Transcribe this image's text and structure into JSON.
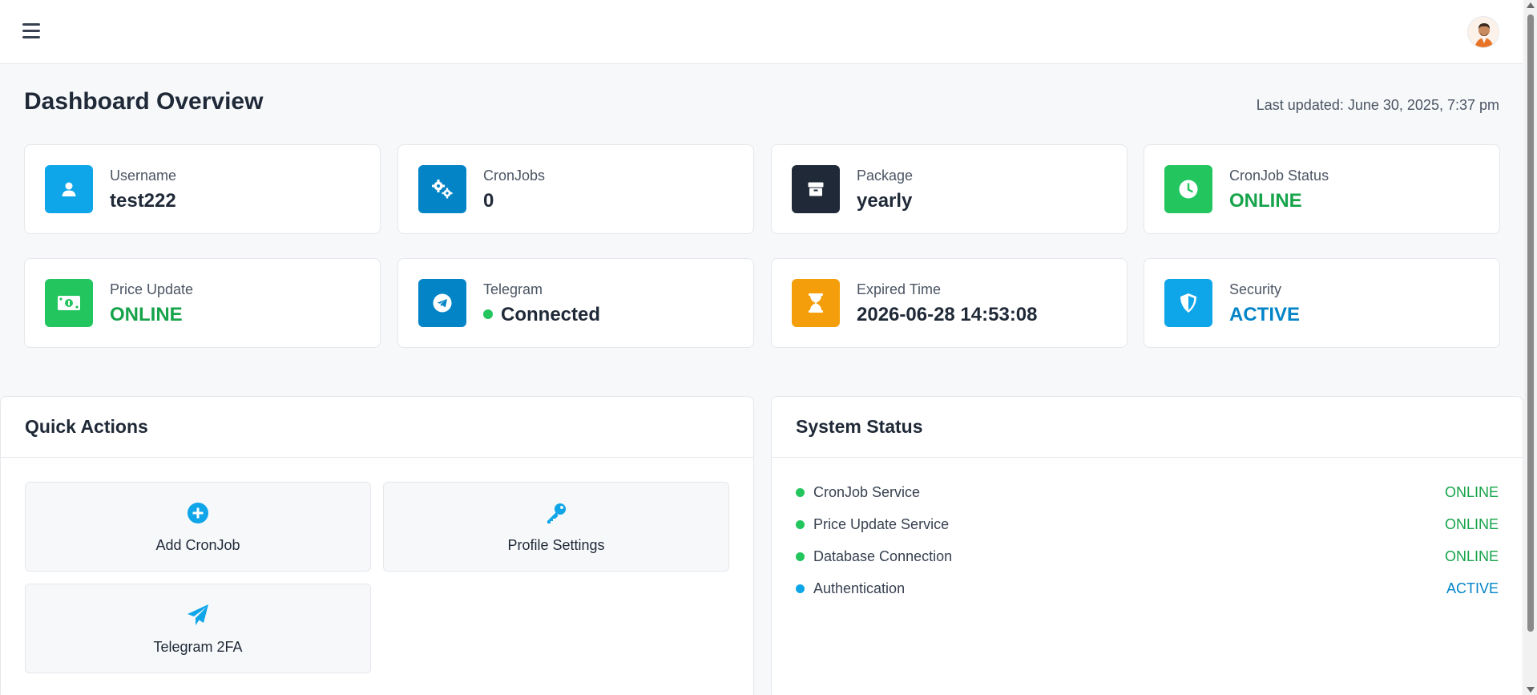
{
  "header": {
    "menu_icon": "hamburger-menu-icon",
    "avatar_icon": "user-avatar"
  },
  "page": {
    "title": "Dashboard Overview",
    "last_updated": "Last updated: June 30, 2025, 7:37 pm"
  },
  "stats": [
    {
      "label": "Username",
      "value": "test222",
      "icon": "user-icon",
      "color": "#0ea5e9"
    },
    {
      "label": "CronJobs",
      "value": "0",
      "icon": "gears-icon",
      "color": "#0284c7"
    },
    {
      "label": "Package",
      "value": "yearly",
      "icon": "box-icon",
      "color": "#1f2937"
    },
    {
      "label": "CronJob Status",
      "value": "ONLINE",
      "icon": "clock-icon",
      "color": "#22c55e"
    },
    {
      "label": "Price Update",
      "value": "ONLINE",
      "icon": "money-icon",
      "color": "#22c55e"
    },
    {
      "label": "Telegram",
      "value": "Connected",
      "icon": "telegram-icon",
      "color": "#0284c7"
    },
    {
      "label": "Expired Time",
      "value": "2026-06-28 14:53:08",
      "icon": "hourglass-icon",
      "color": "#f59e0b"
    },
    {
      "label": "Security",
      "value": "ACTIVE",
      "icon": "shield-icon",
      "color": "#0ea5e9"
    }
  ],
  "quick_actions": {
    "title": "Quick Actions",
    "items": [
      {
        "label": "Add CronJob",
        "icon": "plus-circle-icon"
      },
      {
        "label": "Profile Settings",
        "icon": "key-icon"
      },
      {
        "label": "Telegram 2FA",
        "icon": "paper-plane-icon"
      }
    ]
  },
  "system_status": {
    "title": "System Status",
    "items": [
      {
        "name": "CronJob Service",
        "status": "ONLINE",
        "color": "#16a34a",
        "dot": "#22c55e"
      },
      {
        "name": "Price Update Service",
        "status": "ONLINE",
        "color": "#16a34a",
        "dot": "#22c55e"
      },
      {
        "name": "Database Connection",
        "status": "ONLINE",
        "color": "#16a34a",
        "dot": "#22c55e"
      },
      {
        "name": "Authentication",
        "status": "ACTIVE",
        "color": "#0284c7",
        "dot": "#0ea5e9"
      }
    ]
  }
}
